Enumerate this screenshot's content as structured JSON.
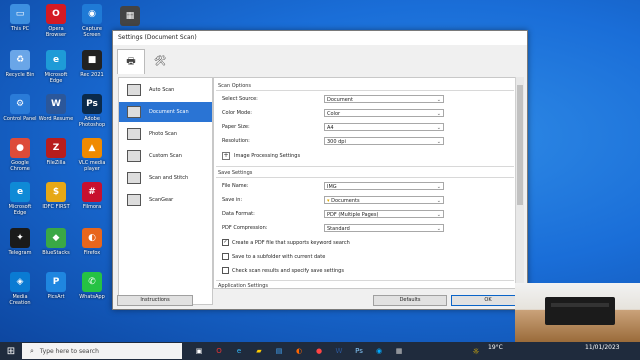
{
  "desktop": {
    "icons": [
      {
        "label": "This PC",
        "color": "#3d8fe0",
        "glyph": "▭"
      },
      {
        "label": "Opera Browser",
        "color": "#d41a23",
        "glyph": "O"
      },
      {
        "label": "Capture Screen",
        "color": "#1f7ad6",
        "glyph": "◉"
      },
      {
        "label": "",
        "color": "#444444",
        "glyph": "▦"
      },
      {
        "label": "Recycle Bin",
        "color": "#6aa6e8",
        "glyph": "♻"
      },
      {
        "label": "Microsoft Edge",
        "color": "#1e9bd7",
        "glyph": "e"
      },
      {
        "label": "Rec 2021",
        "color": "#222222",
        "glyph": "■"
      },
      {
        "label": "Control Panel",
        "color": "#2a7bd8",
        "glyph": "⚙"
      },
      {
        "label": "Word Resume",
        "color": "#2b579a",
        "glyph": "W"
      },
      {
        "label": "Adobe Photoshop",
        "color": "#0b2a4a",
        "glyph": "Ps"
      },
      {
        "label": "Google Chrome",
        "color": "#dd4b39",
        "glyph": "●"
      },
      {
        "label": "FileZilla",
        "color": "#b81d1d",
        "glyph": "Z"
      },
      {
        "label": "VLC media player",
        "color": "#f08a00",
        "glyph": "▲"
      },
      {
        "label": "Microsoft Edge",
        "color": "#0f8ad6",
        "glyph": "e"
      },
      {
        "label": "IDFC FIRST",
        "color": "#e6a817",
        "glyph": "$"
      },
      {
        "label": "Filmora",
        "color": "#c8102e",
        "glyph": "#"
      },
      {
        "label": "Telegram",
        "color": "#1a1a1a",
        "glyph": "✦"
      },
      {
        "label": "BlueStacks",
        "color": "#3aa845",
        "glyph": "◆"
      },
      {
        "label": "Firefox",
        "color": "#e8661c",
        "glyph": "◐"
      },
      {
        "label": "Media Creation",
        "color": "#0a7bd3",
        "glyph": "◈"
      },
      {
        "label": "PicsArt",
        "color": "#1f86e0",
        "glyph": "P"
      },
      {
        "label": "WhatsApp",
        "color": "#25c244",
        "glyph": "✆"
      }
    ]
  },
  "window": {
    "title": "Settings (Document Scan)",
    "tabs": [
      {
        "icon": "scanner-tab-icon",
        "glyph": "🖶"
      },
      {
        "icon": "tools-tab-icon",
        "glyph": "🛠"
      }
    ],
    "nav": [
      {
        "label": "Auto Scan",
        "icon": "auto-scan-icon"
      },
      {
        "label": "Document Scan",
        "icon": "document-scan-icon"
      },
      {
        "label": "Photo Scan",
        "icon": "photo-scan-icon"
      },
      {
        "label": "Custom Scan",
        "icon": "custom-scan-icon"
      },
      {
        "label": "Scan and Stitch",
        "icon": "scan-stitch-icon"
      },
      {
        "label": "ScanGear",
        "icon": "scangear-icon"
      }
    ],
    "scan_options": {
      "header": "Scan Options",
      "fields": [
        {
          "label": "Select Source:",
          "value": "Document"
        },
        {
          "label": "Color Mode:",
          "value": "Color"
        },
        {
          "label": "Paper Size:",
          "value": "A4"
        },
        {
          "label": "Resolution:",
          "value": "300 dpi"
        }
      ],
      "image_processing": "Image Processing Settings"
    },
    "save_settings": {
      "header": "Save Settings",
      "file_name_label": "File Name:",
      "file_name_value": "IMG",
      "save_in_label": "Save in:",
      "save_in_value": "Documents",
      "data_format_label": "Data Format:",
      "data_format_value": "PDF (Multiple Pages)",
      "pdf_compression_label": "PDF Compression:",
      "pdf_compression_value": "Standard",
      "checkboxes": [
        {
          "label": "Create a PDF file that supports keyword search",
          "checked": true
        },
        {
          "label": "Save to a subfolder with current date",
          "checked": false
        },
        {
          "label": "Check scan results and specify save settings",
          "checked": false
        }
      ]
    },
    "app_settings_header": "Application Settings",
    "buttons": {
      "instructions": "Instructions",
      "defaults": "Defaults",
      "ok": "OK"
    }
  },
  "taskbar": {
    "search_placeholder": "Type here to search",
    "temperature": "19°C",
    "time": "11/01/2023"
  }
}
